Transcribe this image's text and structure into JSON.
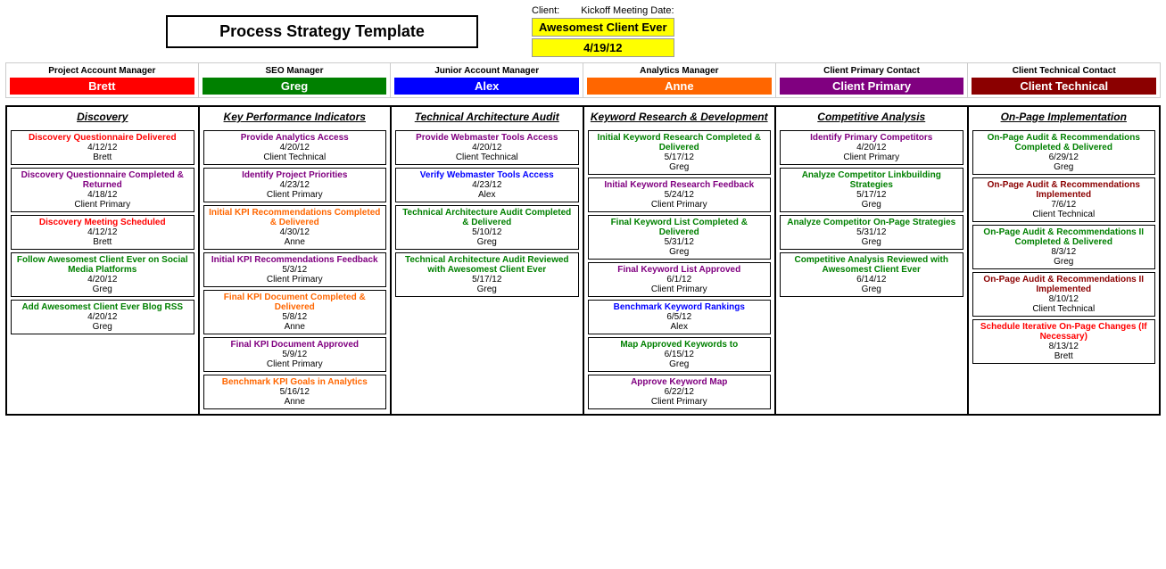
{
  "header": {
    "title": "Process Strategy Template",
    "client_label": "Client:",
    "kickoff_label": "Kickoff Meeting Date:",
    "client_name": "Awesomest Client Ever",
    "kickoff_date": "4/19/12"
  },
  "roles": [
    {
      "title": "Project Account Manager",
      "name": "Brett",
      "color": "bg-red"
    },
    {
      "title": "SEO Manager",
      "name": "Greg",
      "color": "bg-green"
    },
    {
      "title": "Junior Account Manager",
      "name": "Alex",
      "color": "bg-blue"
    },
    {
      "title": "Analytics Manager",
      "name": "Anne",
      "color": "bg-orange"
    },
    {
      "title": "Client Primary Contact",
      "name": "Client Primary",
      "color": "bg-purple"
    },
    {
      "title": "Client Technical Contact",
      "name": "Client Technical",
      "color": "bg-darkred"
    }
  ],
  "columns": [
    {
      "header": "Discovery",
      "tasks": [
        {
          "title": "Discovery Questionnaire Delivered",
          "date": "4/12/12",
          "owner": "Brett",
          "title_color": "red"
        },
        {
          "title": "Discovery Questionnaire Completed & Returned",
          "date": "4/18/12",
          "owner": "Client Primary",
          "title_color": "purple"
        },
        {
          "title": "Discovery Meeting Scheduled",
          "date": "4/12/12",
          "owner": "Brett",
          "title_color": "red"
        },
        {
          "title": "Follow Awesomest Client Ever on Social Media Platforms",
          "date": "4/20/12",
          "owner": "Greg",
          "title_color": "green"
        },
        {
          "title": "Add Awesomest Client Ever Blog RSS",
          "date": "4/20/12",
          "owner": "Greg",
          "title_color": "green"
        }
      ]
    },
    {
      "header": "Key Performance Indicators",
      "tasks": [
        {
          "title": "Provide Analytics Access",
          "date": "4/20/12",
          "owner": "Client Technical",
          "title_color": "purple"
        },
        {
          "title": "Identify Project Priorities",
          "date": "4/23/12",
          "owner": "Client Primary",
          "title_color": "purple"
        },
        {
          "title": "Initial KPI Recommendations Completed & Delivered",
          "date": "4/30/12",
          "owner": "Anne",
          "title_color": "orange"
        },
        {
          "title": "Initial KPI Recommendations Feedback",
          "date": "5/3/12",
          "owner": "Client Primary",
          "title_color": "purple"
        },
        {
          "title": "Final KPI Document Completed & Delivered",
          "date": "5/8/12",
          "owner": "Anne",
          "title_color": "orange"
        },
        {
          "title": "Final KPI Document Approved",
          "date": "5/9/12",
          "owner": "Client Primary",
          "title_color": "purple"
        },
        {
          "title": "Benchmark KPI Goals in Analytics",
          "date": "5/16/12",
          "owner": "Anne",
          "title_color": "orange"
        }
      ]
    },
    {
      "header": "Technical Architecture Audit",
      "tasks": [
        {
          "title": "Provide Webmaster Tools Access",
          "date": "4/20/12",
          "owner": "Client Technical",
          "title_color": "purple"
        },
        {
          "title": "Verify Webmaster Tools Access",
          "date": "4/23/12",
          "owner": "Alex",
          "title_color": "blue"
        },
        {
          "title": "Technical Architecture Audit Completed & Delivered",
          "date": "5/10/12",
          "owner": "Greg",
          "title_color": "green"
        },
        {
          "title": "Technical Architecture Audit Reviewed with Awesomest Client Ever",
          "date": "5/17/12",
          "owner": "Greg",
          "title_color": "green"
        }
      ]
    },
    {
      "header": "Keyword Research & Development",
      "tasks": [
        {
          "title": "Initial Keyword Research Completed & Delivered",
          "date": "5/17/12",
          "owner": "Greg",
          "title_color": "green"
        },
        {
          "title": "Initial Keyword Research Feedback",
          "date": "5/24/12",
          "owner": "Client Primary",
          "title_color": "purple"
        },
        {
          "title": "Final Keyword List Completed & Delivered",
          "date": "5/31/12",
          "owner": "Greg",
          "title_color": "green"
        },
        {
          "title": "Final Keyword List Approved",
          "date": "6/1/12",
          "owner": "Client Primary",
          "title_color": "purple"
        },
        {
          "title": "Benchmark Keyword Rankings",
          "date": "6/5/12",
          "owner": "Alex",
          "title_color": "blue"
        },
        {
          "title": "Map Approved Keywords to",
          "date": "6/15/12",
          "owner": "Greg",
          "title_color": "green"
        },
        {
          "title": "Approve Keyword Map",
          "date": "6/22/12",
          "owner": "Client Primary",
          "title_color": "purple"
        }
      ]
    },
    {
      "header": "Competitive Analysis",
      "tasks": [
        {
          "title": "Identify Primary Competitors",
          "date": "4/20/12",
          "owner": "Client Primary",
          "title_color": "purple"
        },
        {
          "title": "Analyze Competitor Linkbuilding Strategies",
          "date": "5/17/12",
          "owner": "Greg",
          "title_color": "green"
        },
        {
          "title": "Analyze Competitor On-Page Strategies",
          "date": "5/31/12",
          "owner": "Greg",
          "title_color": "green"
        },
        {
          "title": "Competitive Analysis Reviewed with Awesomest Client Ever",
          "date": "6/14/12",
          "owner": "Greg",
          "title_color": "green"
        }
      ]
    },
    {
      "header": "On-Page Implementation",
      "tasks": [
        {
          "title": "On-Page Audit & Recommendations Completed & Delivered",
          "date": "6/29/12",
          "owner": "Greg",
          "title_color": "green"
        },
        {
          "title": "On-Page Audit & Recommendations Implemented",
          "date": "7/6/12",
          "owner": "Client Technical",
          "title_color": "darkred"
        },
        {
          "title": "On-Page Audit & Recommendations II Completed & Delivered",
          "date": "8/3/12",
          "owner": "Greg",
          "title_color": "green"
        },
        {
          "title": "On-Page Audit & Recommendations II Implemented",
          "date": "8/10/12",
          "owner": "Client Technical",
          "title_color": "darkred"
        },
        {
          "title": "Schedule Iterative On-Page Changes (If Necessary)",
          "date": "8/13/12",
          "owner": "Brett",
          "title_color": "red"
        }
      ]
    }
  ]
}
